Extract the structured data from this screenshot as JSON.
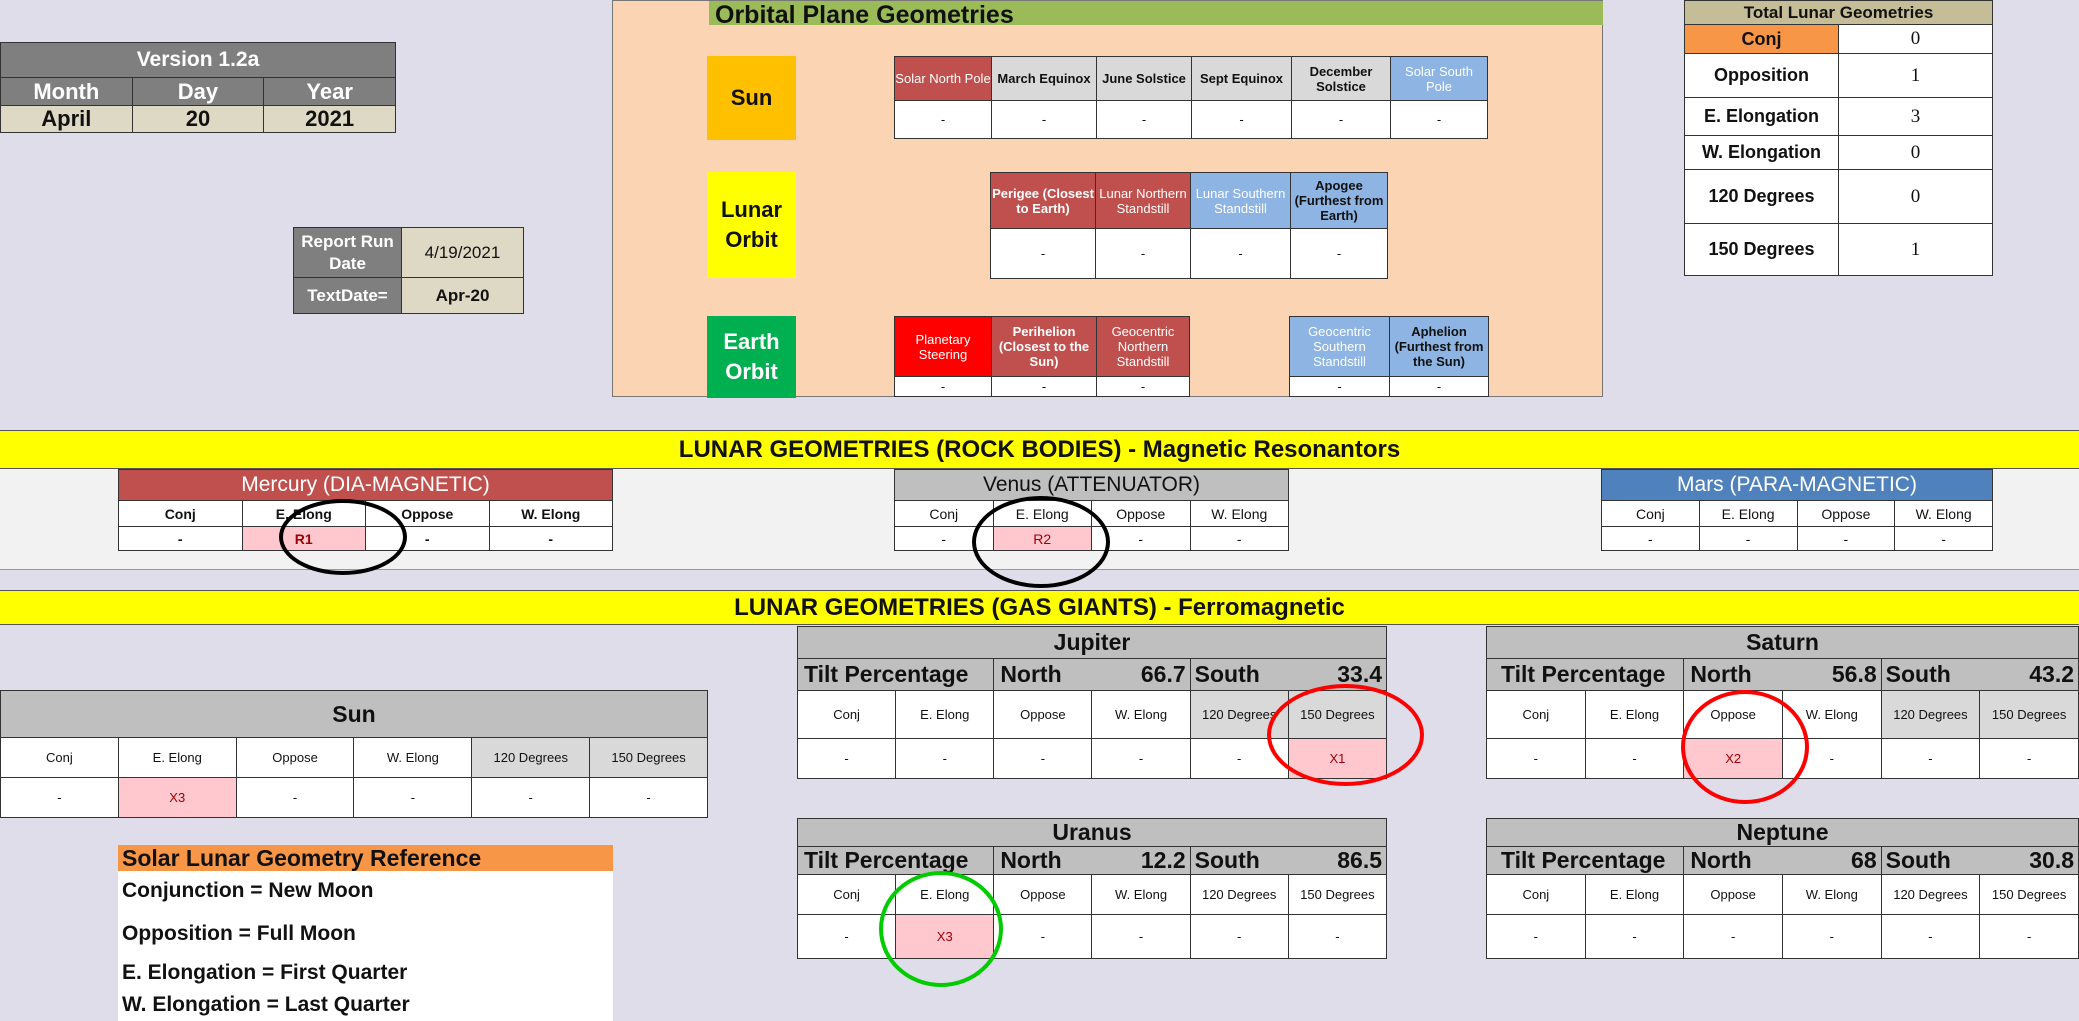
{
  "version": {
    "title": "Version 1.2a",
    "headers": [
      "Month",
      "Day",
      "Year"
    ],
    "values": [
      "April",
      "20",
      "2021"
    ]
  },
  "report": {
    "run_label": "Report Run Date",
    "run_value": "4/19/2021",
    "text_label": "TextDate=",
    "text_value": "Apr-20"
  },
  "orbital": {
    "title": "Orbital Plane Geometries",
    "sun": {
      "label": "Sun",
      "headers": [
        "Solar North Pole",
        "March Equinox",
        "June Solstice",
        "Sept Equinox",
        "December Solstice",
        "Solar South Pole"
      ],
      "values": [
        "-",
        "-",
        "-",
        "-",
        "-",
        "-"
      ]
    },
    "lunar": {
      "label": "Lunar Orbit",
      "headers": [
        "Perigee (Closest to Earth)",
        "Lunar Northern Standstill",
        "Lunar Southern Standstill",
        "Apogee (Furthest from Earth)"
      ],
      "values": [
        "-",
        "-",
        "-",
        "-"
      ]
    },
    "earth": {
      "label": "Earth Orbit",
      "headers": [
        "Planetary Steering",
        "Perihelion (Closest to the Sun)",
        "Geocentric Northern Standstill",
        "Geocentric Southern Standstill",
        "Aphelion (Furthest from the Sun)"
      ],
      "values": [
        "-",
        "-",
        "-",
        "-",
        "-"
      ]
    }
  },
  "totals": {
    "title": "Total Lunar Geometries",
    "rows": [
      {
        "label": "Conj",
        "value": "0"
      },
      {
        "label": "Opposition",
        "value": "1"
      },
      {
        "label": "E. Elongation",
        "value": "3"
      },
      {
        "label": "W. Elongation",
        "value": "0"
      },
      {
        "label": "120 Degrees",
        "value": "0"
      },
      {
        "label": "150 Degrees",
        "value": "1"
      }
    ]
  },
  "rock": {
    "title": "LUNAR GEOMETRIES (ROCK BODIES) - Magnetic Resonantors",
    "headers": [
      "Conj",
      "E. Elong",
      "Oppose",
      "W. Elong"
    ],
    "mercury": {
      "name": "Mercury (DIA-MAGNETIC)",
      "values": [
        "-",
        "R1",
        "-",
        "-"
      ]
    },
    "venus": {
      "name": "Venus (ATTENUATOR)",
      "values": [
        "-",
        "R2",
        "-",
        "-"
      ]
    },
    "mars": {
      "name": "Mars (PARA-MAGNETIC)",
      "values": [
        "-",
        "-",
        "-",
        "-"
      ]
    }
  },
  "gas": {
    "title": "LUNAR GEOMETRIES (GAS GIANTS) - Ferromagnetic",
    "headers": [
      "Conj",
      "E. Elong",
      "Oppose",
      "W. Elong",
      "120 Degrees",
      "150 Degrees"
    ],
    "tilt_label": "Tilt Percentage",
    "north_label": "North",
    "south_label": "South",
    "sun": {
      "name": "Sun",
      "values": [
        "-",
        "X3",
        "-",
        "-",
        "-",
        "-"
      ]
    },
    "jupiter": {
      "name": "Jupiter",
      "north": "66.7",
      "south": "33.4",
      "values": [
        "-",
        "-",
        "-",
        "-",
        "-",
        "X1"
      ]
    },
    "saturn": {
      "name": "Saturn",
      "north": "56.8",
      "south": "43.2",
      "values": [
        "-",
        "-",
        "X2",
        "-",
        "-",
        "-"
      ]
    },
    "uranus": {
      "name": "Uranus",
      "north": "12.2",
      "south": "86.5",
      "values": [
        "-",
        "X3",
        "-",
        "-",
        "-",
        "-"
      ]
    },
    "neptune": {
      "name": "Neptune",
      "north": "68",
      "south": "30.8",
      "values": [
        "-",
        "-",
        "-",
        "-",
        "-",
        "-"
      ]
    }
  },
  "reference": {
    "title": "Solar Lunar Geometry Reference",
    "lines": [
      "Conjunction = New Moon",
      "Opposition = Full Moon",
      "E. Elongation = First Quarter",
      "W. Elongation = Last Quarter"
    ]
  },
  "colors": {
    "header_gray": "#7f7f7f",
    "cream": "#ddd9c4",
    "orbital_bg": "#fbd4b4",
    "orbital_title": "#9bbb59",
    "sun_yellow": "#ffc000",
    "lunar_yellow": "#ffff00",
    "earth_green": "#00b050",
    "red_header": "#c0504d",
    "blue_header": "#8db4e2",
    "bright_red": "#ff0000",
    "totals_header": "#c4bd97",
    "orange": "#f79646",
    "bar_yellow": "#ffff00",
    "ring_black": "#000000",
    "ring_red": "#ff0000",
    "ring_green": "#00cc00"
  }
}
